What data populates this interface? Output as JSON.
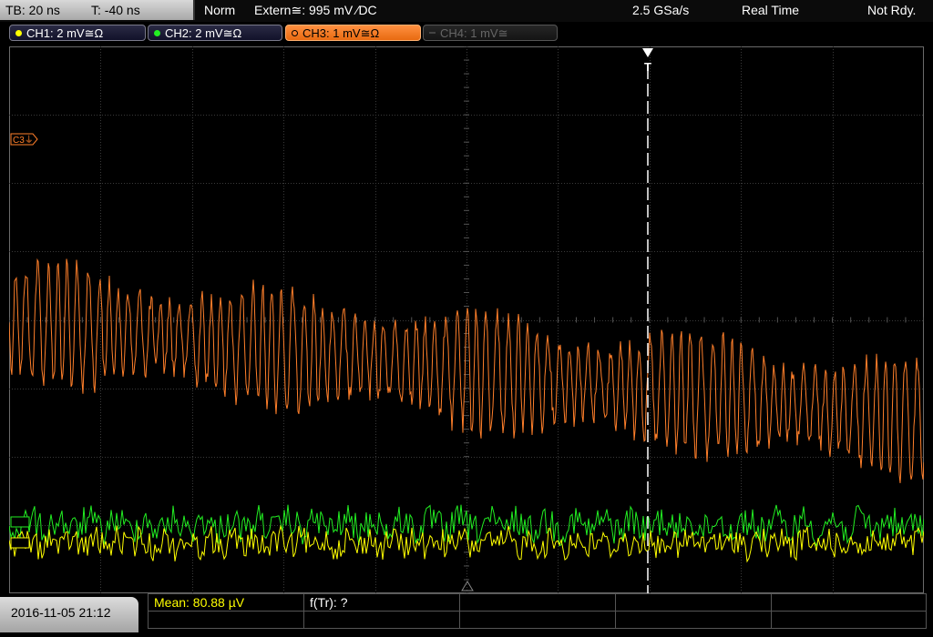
{
  "header": {
    "timebase": "TB: 20 ns",
    "trigger_time": "T: -40 ns",
    "mode": "Norm",
    "trigger_source": "Extern≅: 995 mV ∕DC",
    "sample_rate": "2.5 GSa/s",
    "acq_mode": "Real Time",
    "status": "Not Rdy."
  },
  "channels": [
    {
      "label": "CH1: 2 mV≅Ω",
      "color": "#ffff00",
      "state": "on"
    },
    {
      "label": "CH2: 2 mV≅Ω",
      "color": "#22ee22",
      "state": "on"
    },
    {
      "label": "CH3: 1 mV≅Ω",
      "color": "#ff7f2a",
      "state": "active"
    },
    {
      "label": "CH4: 1 mV≅",
      "color": "#555555",
      "state": "off"
    }
  ],
  "markers": {
    "c3": "C3⏚",
    "trigger": "T"
  },
  "footer": {
    "datetime": "2016-11-05 21:12",
    "mean": "Mean: 80.88 µV",
    "freq": "f(Tr): ?"
  },
  "colors": {
    "grid": "#3a3a3a",
    "ch3": "#ff7f2a",
    "ch2": "#22ee22",
    "ch1": "#ffff00",
    "mean_text": "#ffff00"
  }
}
